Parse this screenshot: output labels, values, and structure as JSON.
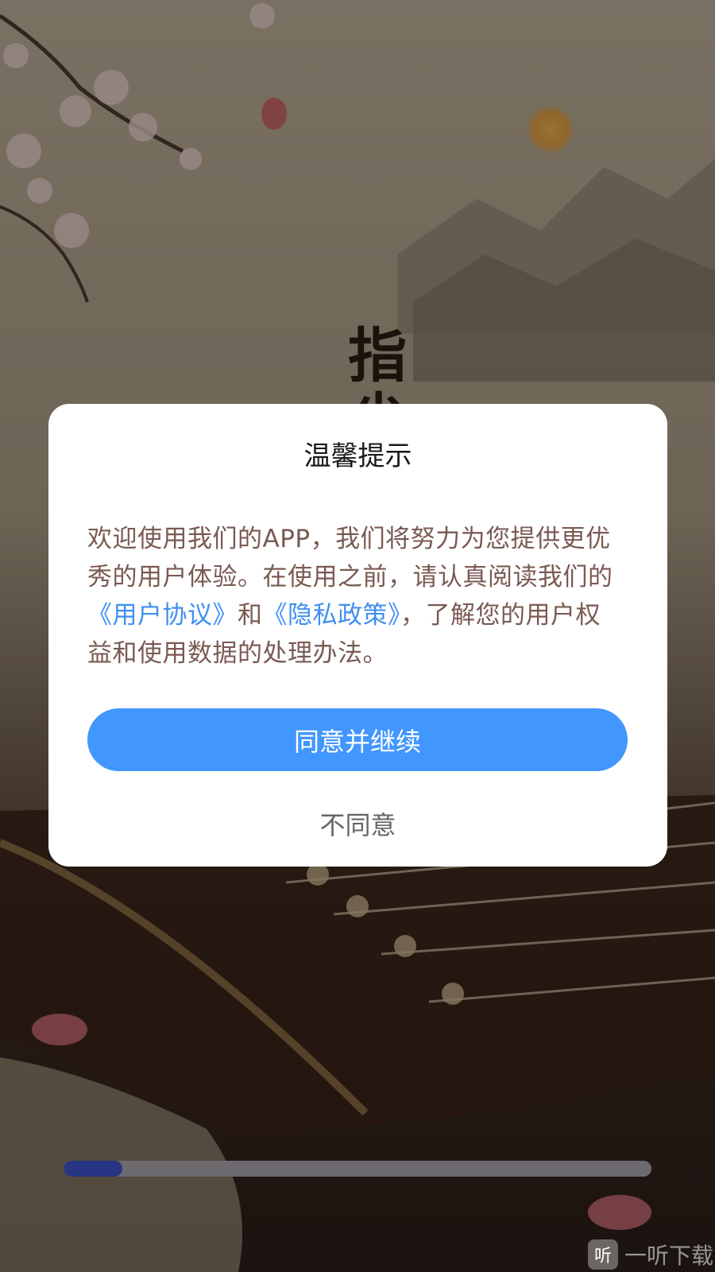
{
  "splash": {
    "logo_chars": [
      "指",
      "尖"
    ]
  },
  "dialog": {
    "title": "温馨提示",
    "body_part1": "欢迎使用我们的APP，我们将努力为您提供更优秀的用户体验。在使用之前，请认真阅读我们的",
    "link_user_agreement": "《用户协议》",
    "body_and": "和",
    "link_privacy_policy": "《隐私政策》",
    "body_part2": "，了解您的用户权益和使用数据的处理办法。",
    "agree_label": "同意并继续",
    "disagree_label": "不同意"
  },
  "progress": {
    "value_percent": 10,
    "fill_color": "#283583",
    "track_color": "#6c6a6e"
  },
  "watermark": {
    "icon_char": "听",
    "text": "一听下载"
  },
  "colors": {
    "accent": "#4197fd",
    "link": "#3f8ff0"
  }
}
